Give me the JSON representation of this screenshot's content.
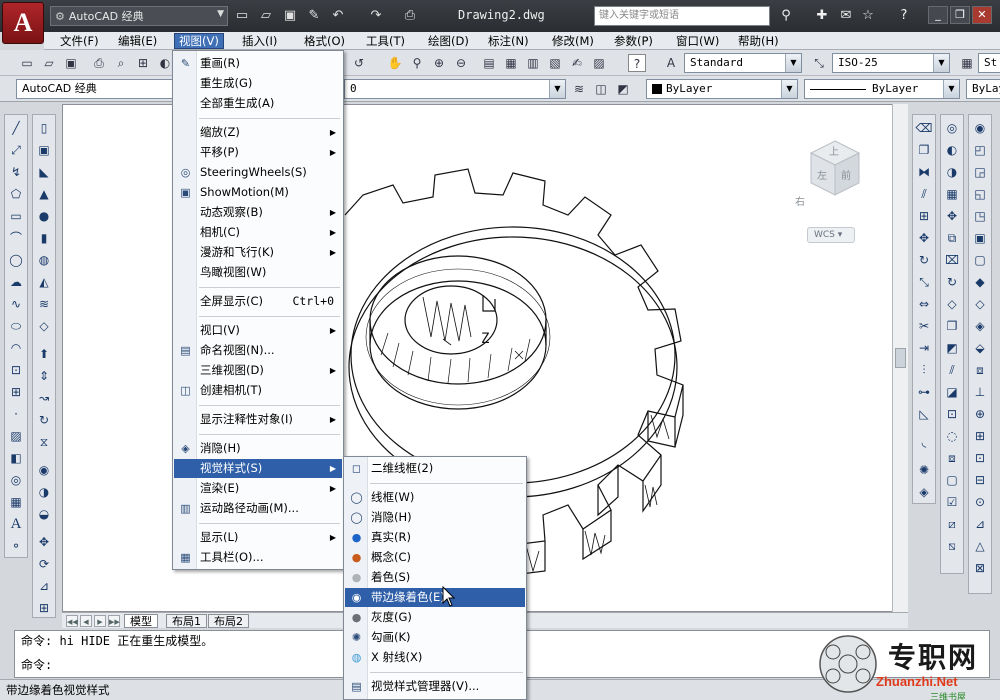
{
  "title_bar": {
    "app_button": "A",
    "workspace": "AutoCAD 经典",
    "document_title": "Drawing2.dwg",
    "search_placeholder": "键入关键字或短语"
  },
  "menubar": [
    "文件(F)",
    "编辑(E)",
    "视图(V)",
    "插入(I)",
    "格式(O)",
    "工具(T)",
    "绘图(D)",
    "标注(N)",
    "修改(M)",
    "参数(P)",
    "窗口(W)",
    "帮助(H)"
  ],
  "toolbar2": {
    "workspace_label": "AutoCAD 经典",
    "layer_value": "0",
    "color": "ByLayer",
    "linetype": "ByLayer",
    "lineweight": "ByLayer"
  },
  "style_toolbar": {
    "text_style": "Standard",
    "dim_style": "ISO-25",
    "table_style": "St"
  },
  "view_menu": [
    {
      "label": "重画(R)",
      "icon": "pencil-icon"
    },
    {
      "label": "重生成(G)"
    },
    {
      "label": "全部重生成(A)"
    },
    {
      "sep": true
    },
    {
      "label": "缩放(Z)",
      "sub": true
    },
    {
      "label": "平移(P)",
      "sub": true
    },
    {
      "label": "SteeringWheels(S)",
      "icon": "wheel-icon"
    },
    {
      "label": "ShowMotion(M)",
      "icon": "showmotion-icon"
    },
    {
      "label": "动态观察(B)",
      "sub": true
    },
    {
      "label": "相机(C)",
      "sub": true
    },
    {
      "label": "漫游和飞行(K)",
      "sub": true
    },
    {
      "label": "鸟瞰视图(W)"
    },
    {
      "sep": true
    },
    {
      "label": "全屏显示(C)",
      "shortcut": "Ctrl+0"
    },
    {
      "sep": true
    },
    {
      "label": "视口(V)",
      "sub": true
    },
    {
      "label": "命名视图(N)...",
      "icon": "named-view-icon"
    },
    {
      "label": "三维视图(D)",
      "sub": true
    },
    {
      "label": "创建相机(T)",
      "icon": "camera-icon"
    },
    {
      "sep": true
    },
    {
      "label": "显示注释性对象(I)",
      "sub": true
    },
    {
      "sep": true
    },
    {
      "label": "消隐(H)",
      "icon": "hide-icon"
    },
    {
      "label": "视觉样式(S)",
      "sub": true,
      "highlight": true
    },
    {
      "label": "渲染(E)",
      "sub": true
    },
    {
      "label": "运动路径动画(M)...",
      "icon": "motion-path-icon"
    },
    {
      "sep": true
    },
    {
      "label": "显示(L)",
      "sub": true
    },
    {
      "label": "工具栏(O)...",
      "icon": "toolbar-icon"
    }
  ],
  "visual_style_menu": [
    {
      "label": "二维线框(2)",
      "icon": "wireframe2d-icon"
    },
    {
      "sep": true
    },
    {
      "label": "线框(W)",
      "icon": "wireframe-icon"
    },
    {
      "label": "消隐(H)",
      "icon": "hidden-icon"
    },
    {
      "label": "真实(R)",
      "icon": "realistic-icon"
    },
    {
      "label": "概念(C)",
      "icon": "conceptual-icon"
    },
    {
      "label": "着色(S)",
      "icon": "shaded-icon"
    },
    {
      "label": "带边缘着色(E)",
      "icon": "shaded-edges-icon",
      "highlight": true
    },
    {
      "label": "灰度(G)",
      "icon": "grayscale-icon"
    },
    {
      "label": "勾画(K)",
      "icon": "sketchy-icon"
    },
    {
      "label": "X 射线(X)",
      "icon": "xray-icon"
    },
    {
      "sep": true
    },
    {
      "label": "视觉样式管理器(V)...",
      "icon": "style-manager-icon"
    }
  ],
  "viewcube": {
    "top": "上",
    "left": "左",
    "front": "前",
    "right": "右",
    "wcs": "WCS"
  },
  "tabs": [
    "模型",
    "布局1",
    "布局2"
  ],
  "command_lines": [
    "命令: hi HIDE 正在重生成模型。",
    "命令:"
  ],
  "status_text": "带边缘着色视觉样式",
  "watermark": {
    "title": "专职网",
    "url": "Zhuanzhi.Net",
    "sub": "三维书屋"
  },
  "colors": {
    "highlight": "#2f5fa8",
    "title_bar": "#2a2d31",
    "app_button": "#b0262a"
  }
}
